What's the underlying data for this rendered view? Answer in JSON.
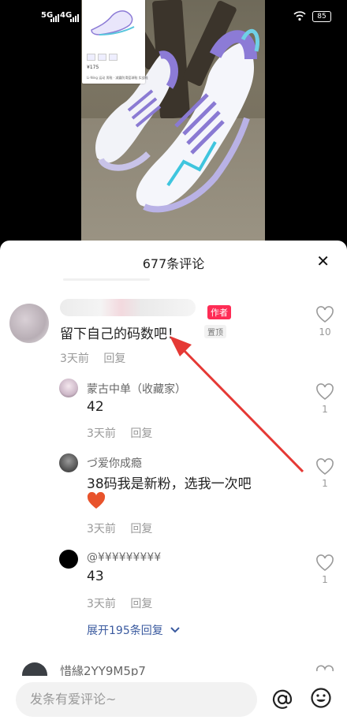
{
  "status": {
    "sim1": "5G",
    "sim2": "4G",
    "battery": "85"
  },
  "thumbnail": {
    "price": "¥175",
    "description": "Li-Ning 运动 男鞋 · 减震防滑篮球鞋 实战鞋"
  },
  "panel": {
    "title": "677条评论",
    "close_label": "✕"
  },
  "comments": [
    {
      "text": "留下自己的码数吧！",
      "author_tag": "作者",
      "pin_tag": "置顶",
      "time": "3天前",
      "reply": "回复",
      "likes": "10"
    }
  ],
  "replies": [
    {
      "name": "蒙古中单（收藏家）",
      "text": "42",
      "time": "3天前",
      "reply": "回复",
      "likes": "1"
    },
    {
      "name": "づ爱你成瘾",
      "text": "38码我是新粉，选我一次吧",
      "time": "3天前",
      "reply": "回复",
      "likes": "1"
    },
    {
      "name": "@¥¥¥¥¥¥¥¥¥",
      "text": "43",
      "time": "3天前",
      "reply": "回复",
      "likes": "1"
    }
  ],
  "expand_label": "展开195条回复",
  "next_comment": {
    "name": "惜緣2YY9M5p7"
  },
  "input": {
    "placeholder": "发条有爱评论~"
  },
  "icons": {
    "at": "at-icon",
    "emoji": "emoji-icon",
    "heart": "heart-outline-icon",
    "close": "close-icon"
  },
  "colors": {
    "accent": "#fe2c55",
    "link": "#3a5a9f",
    "annotation_arrow": "#e53935"
  }
}
